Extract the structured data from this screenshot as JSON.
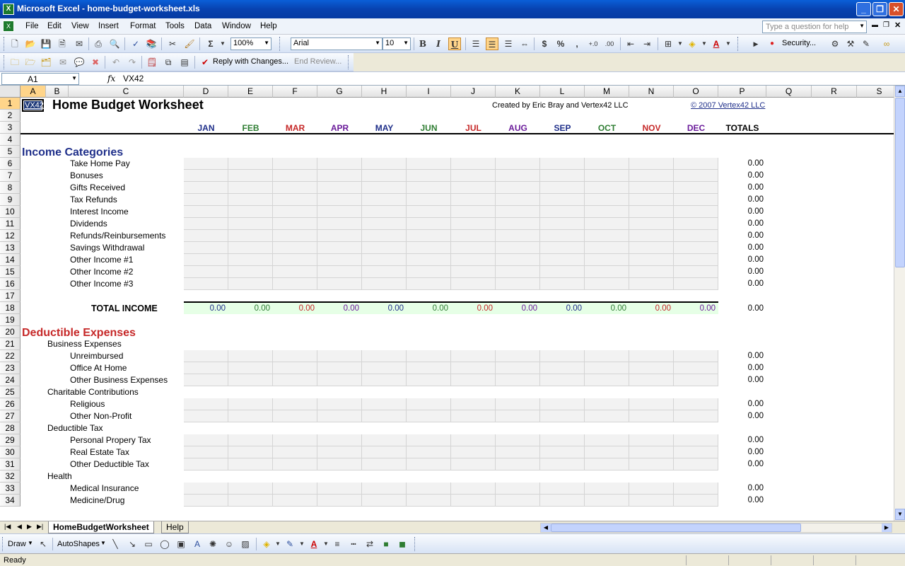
{
  "window": {
    "title": "Microsoft Excel - home-budget-worksheet.xls",
    "app_icon": "excel-icon",
    "minimize": "_",
    "maximize": "❐",
    "close": "✕"
  },
  "menu": {
    "items": [
      "File",
      "Edit",
      "View",
      "Insert",
      "Format",
      "Tools",
      "Data",
      "Window",
      "Help"
    ],
    "help_placeholder": "Type a question for help"
  },
  "toolbar": {
    "zoom": "100%",
    "font": "Arial",
    "font_size": "10",
    "security_label": "Security...",
    "reply_label": "Reply with Changes...",
    "end_review_label": "End Review..."
  },
  "formula_bar": {
    "name_box": "A1",
    "fx": "fx",
    "value": "VX42"
  },
  "columns": [
    "A",
    "B",
    "C",
    "D",
    "E",
    "F",
    "G",
    "H",
    "I",
    "J",
    "K",
    "L",
    "M",
    "N",
    "O",
    "P",
    "Q",
    "R",
    "S"
  ],
  "rows": [
    "1",
    "2",
    "3",
    "4",
    "5",
    "6",
    "7",
    "8",
    "9",
    "10",
    "11",
    "12",
    "13",
    "14",
    "15",
    "16",
    "17",
    "18",
    "19",
    "20",
    "21",
    "22",
    "23",
    "24",
    "25",
    "26",
    "27",
    "28",
    "29",
    "30",
    "31",
    "32",
    "33",
    "34"
  ],
  "sheet": {
    "logo_text": "VX42",
    "title": "Home Budget Worksheet",
    "created_by": "Created by Eric Bray and Vertex42 LLC",
    "copyright": "© 2007 Vertex42 LLC",
    "months": [
      "JAN",
      "FEB",
      "MAR",
      "APR",
      "MAY",
      "JUN",
      "JUL",
      "AUG",
      "SEP",
      "OCT",
      "NOV",
      "DEC"
    ],
    "month_colors": [
      "#1F2F8A",
      "#2E7D32",
      "#C62828",
      "#6A1B9A",
      "#1F2F8A",
      "#2E7D32",
      "#C62828",
      "#6A1B9A",
      "#1F2F8A",
      "#2E7D32",
      "#C62828",
      "#6A1B9A"
    ],
    "totals_header": "TOTALS",
    "income_heading": "Income Categories",
    "income_color": "#1F2F8A",
    "income_items": [
      "Take Home Pay",
      "Bonuses",
      "Gifts Received",
      "Tax Refunds",
      "Interest Income",
      "Dividends",
      "Refunds/Reinbursements",
      "Savings Withdrawal",
      "Other Income #1",
      "Other Income #2",
      "Other Income #3"
    ],
    "total_income_label": "TOTAL INCOME",
    "total_income_values": [
      "0.00",
      "0.00",
      "0.00",
      "0.00",
      "0.00",
      "0.00",
      "0.00",
      "0.00",
      "0.00",
      "0.00",
      "0.00",
      "0.00"
    ],
    "zero": "0.00",
    "deductible_heading": "Deductible Expenses",
    "deductible_color": "#C62828",
    "groups": [
      {
        "name": "Business Expenses",
        "items": [
          "Unreimbursed",
          "Office At Home",
          "Other Business Expenses"
        ]
      },
      {
        "name": "Charitable Contributions",
        "items": [
          "Religious",
          "Other Non-Profit"
        ]
      },
      {
        "name": "Deductible Tax",
        "items": [
          "Personal Propery Tax",
          "Real Estate Tax",
          "Other Deductible Tax"
        ]
      },
      {
        "name": "Health",
        "items": [
          "Medical Insurance",
          "Medicine/Drug"
        ]
      }
    ]
  },
  "tabs": {
    "active": "HomeBudgetWorksheet",
    "other": "Help"
  },
  "drawbar": {
    "draw_label": "Draw",
    "autoshapes_label": "AutoShapes"
  },
  "status": {
    "text": "Ready"
  }
}
